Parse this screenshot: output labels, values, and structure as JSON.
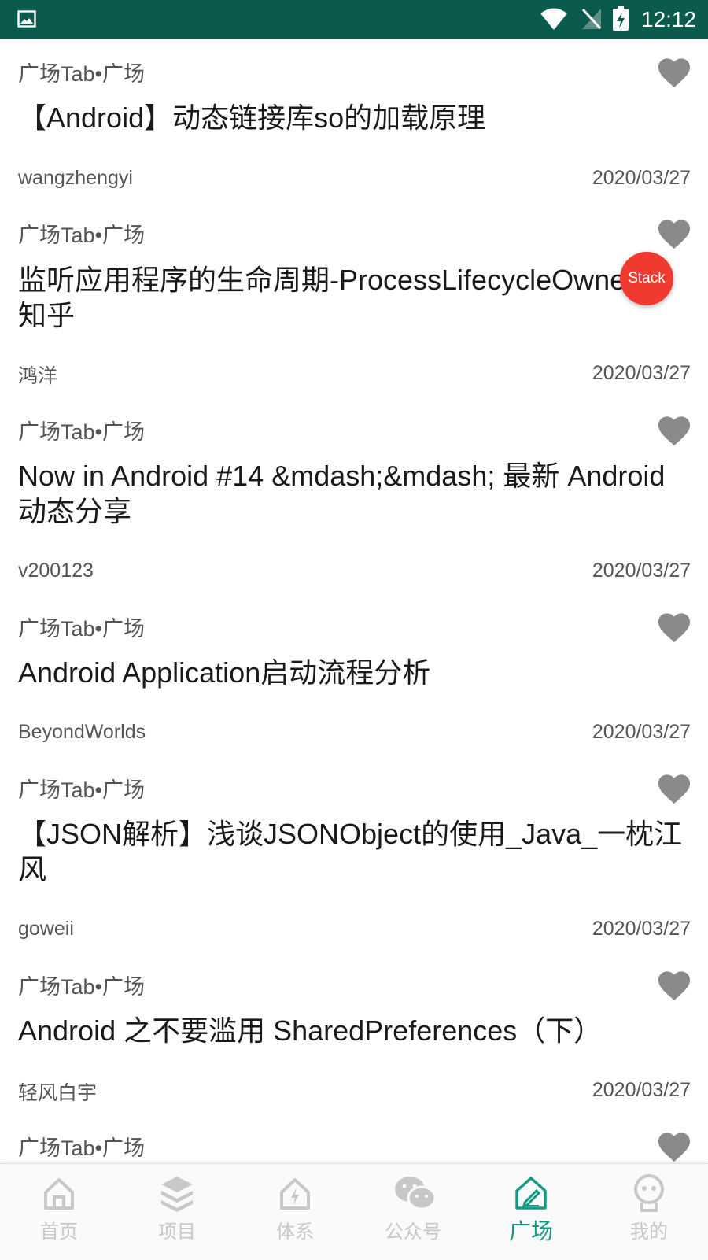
{
  "status_bar": {
    "time": "12:12"
  },
  "articles": [
    {
      "tag": "广场Tab•广场",
      "title": "【Android】动态链接库so的加载原理",
      "author": "wangzhengyi",
      "date": "2020/03/27"
    },
    {
      "tag": "广场Tab•广场",
      "title": "监听应用程序的生命周期-ProcessLifecycleOwner - 知乎",
      "author": "鸿洋",
      "date": "2020/03/27"
    },
    {
      "tag": "广场Tab•广场",
      "title": "Now in Android #14 &mdash;&mdash; 最新 Android 动态分享",
      "author": "v200123",
      "date": "2020/03/27"
    },
    {
      "tag": "广场Tab•广场",
      "title": "Android Application启动流程分析",
      "author": "BeyondWorlds",
      "date": "2020/03/27"
    },
    {
      "tag": "广场Tab•广场",
      "title": "【JSON解析】浅谈JSONObject的使用_Java_一枕江风",
      "author": "goweii",
      "date": "2020/03/27"
    },
    {
      "tag": "广场Tab•广场",
      "title": "Android 之不要滥用 SharedPreferences（下）",
      "author": "轻风白宇",
      "date": "2020/03/27"
    },
    {
      "tag": "广场Tab•广场",
      "title": "",
      "author": "",
      "date": ""
    }
  ],
  "floating_button": {
    "label": "Stack"
  },
  "bottom_nav": {
    "items": [
      {
        "label": "首页",
        "icon": "home-icon"
      },
      {
        "label": "项目",
        "icon": "layers-icon"
      },
      {
        "label": "体系",
        "icon": "system-icon"
      },
      {
        "label": "公众号",
        "icon": "wechat-icon"
      },
      {
        "label": "广场",
        "icon": "square-icon",
        "active": true
      },
      {
        "label": "我的",
        "icon": "profile-icon"
      }
    ],
    "active_color": "#129a85",
    "inactive_color": "#c8c8c8"
  },
  "colors": {
    "status_bar": "#0b5a4e",
    "heart": "#8a8a8a",
    "fab": "#f0392f"
  }
}
